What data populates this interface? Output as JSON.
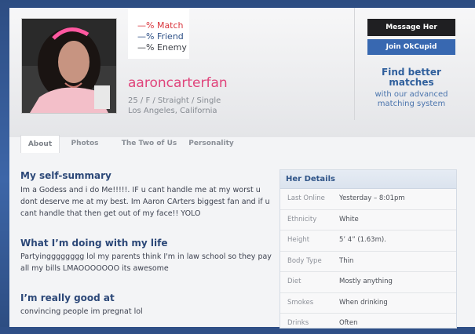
{
  "profile": {
    "match": "—% Match",
    "friend": "—% Friend",
    "enemy": "—% Enemy",
    "username": "aaroncarterfan",
    "line1": "25 / F / Straight / Single",
    "line2": "Los Angeles, California"
  },
  "actions": {
    "message_label": "Message Her",
    "join_label": "Join OkCupid",
    "promo_title": "Find better matches",
    "promo_sub": "with our advanced matching system"
  },
  "tabs": [
    {
      "label": "About",
      "active": true
    },
    {
      "label": "Photos",
      "active": false
    },
    {
      "label": "The Two of Us",
      "active": false
    },
    {
      "label": "Personality",
      "active": false
    }
  ],
  "sections": [
    {
      "title": "My self-summary",
      "body": "Im a Godess and i do Me!!!!!. IF u cant handle me at my worst u dont deserve me at my best. Im Aaron CArters biggest fan and if u cant handle that then get out of my face!! YOLO"
    },
    {
      "title": "What I’m doing with my life",
      "body": "Partyingggggggg lol my parents think I'm in law school so they pay all my bills LMAOOOOOOO its awesome"
    },
    {
      "title": "I’m really good at",
      "body": "convincing people im pregnat lol"
    }
  ],
  "details": {
    "title": "Her Details",
    "rows": [
      {
        "label": "Last Online",
        "value": "Yesterday – 8:01pm"
      },
      {
        "label": "Ethnicity",
        "value": "White"
      },
      {
        "label": "Height",
        "value": "5’ 4” (1.63m)."
      },
      {
        "label": "Body Type",
        "value": "Thin"
      },
      {
        "label": "Diet",
        "value": "Mostly anything"
      },
      {
        "label": "Smokes",
        "value": "When drinking"
      },
      {
        "label": "Drinks",
        "value": "Often"
      }
    ]
  },
  "icons": [
    "profile-photo"
  ],
  "colors": {
    "accent": "#e0447b",
    "brand_blue": "#3868b1",
    "dark_button": "#1f1f22"
  }
}
